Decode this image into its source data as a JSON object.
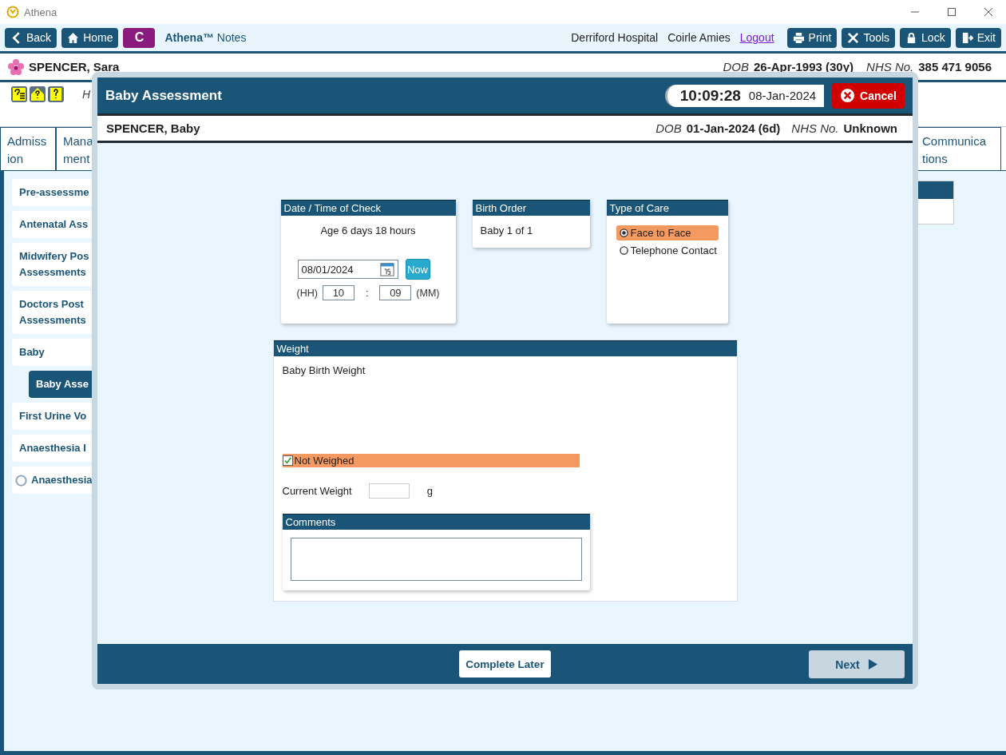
{
  "window": {
    "title": "Athena"
  },
  "toolbar": {
    "nav_buttons": [
      {
        "label": "Back"
      },
      {
        "label": "Home"
      }
    ],
    "c_button": "C",
    "app_name": "**Athena™** Notes",
    "hospital": "Derriford Hospital",
    "user": "Coirle Amies",
    "logout": "Logout",
    "actions": [
      {
        "label": "Print"
      },
      {
        "label": "Tools"
      },
      {
        "label": "Lock"
      },
      {
        "label": "Exit"
      }
    ]
  },
  "patient": {
    "name": "SPENCER, Sara",
    "dob_label": "DOB",
    "dob": "26-Apr-1993 (30y)",
    "nhs_label": "NHS No.",
    "nhs": "385 471 9056"
  },
  "alert_text": "H",
  "tabs": [
    {
      "lines": [
        "Admiss",
        "ion"
      ]
    },
    {
      "lines": [
        "Mana",
        "ment"
      ]
    },
    {
      "lines": [
        "Communica",
        "tions"
      ]
    }
  ],
  "sidebar": {
    "items": [
      {
        "lines": [
          "Pre-assessme"
        ],
        "kind": "plain",
        "selected": false
      },
      {
        "lines": [
          "Antenatal Ass"
        ],
        "kind": "plain",
        "selected": false
      },
      {
        "lines": [
          "Midwifery Pos",
          "Assessments"
        ],
        "kind": "plain",
        "selected": false
      },
      {
        "lines": [
          "Doctors Post",
          "Assessments"
        ],
        "kind": "plain",
        "selected": false
      },
      {
        "lines": [
          "Baby"
        ],
        "kind": "plain",
        "selected": false,
        "children": [
          {
            "lines": [
              "Baby Asse"
            ],
            "selected": true
          }
        ]
      },
      {
        "lines": [
          "First Urine Vo"
        ],
        "kind": "plain",
        "selected": false
      },
      {
        "lines": [
          "Anaesthesia I"
        ],
        "kind": "plain",
        "selected": false
      },
      {
        "lines": [
          "Anaesthesia"
        ],
        "kind": "radio",
        "selected": false
      }
    ]
  },
  "modal": {
    "title": "Baby Assessment",
    "time": "10:09:28",
    "date": "08-Jan-2024",
    "cancel": "Cancel",
    "baby": {
      "name": "SPENCER, Baby",
      "dob_label": "DOB",
      "dob": "01-Jan-2024 (6d)",
      "nhs_label": "NHS No.",
      "nhs": "Unknown"
    },
    "date_card": {
      "title": "Date / Time of Check",
      "age": "Age 6 days 18 hours",
      "date": "08/01/2024",
      "now": "Now",
      "hh_label": "(HH)",
      "hh": "10",
      "sep": ":",
      "mm": "09",
      "mm_label": "(MM)"
    },
    "birth_order": {
      "title": "Birth Order",
      "value": "Baby 1 of 1"
    },
    "type_of_care": {
      "title": "Type of Care",
      "options": [
        {
          "label": "Face to Face",
          "selected": true
        },
        {
          "label": "Telephone Contact",
          "selected": false
        }
      ]
    },
    "weight": {
      "title": "Weight",
      "birth_weight_label": "Baby Birth Weight",
      "not_weighed": {
        "label": "Not Weighed",
        "checked": true
      },
      "current_weight_label": "Current Weight",
      "unit": "g",
      "comments_title": "Comments"
    },
    "footer": {
      "complete_later": "Complete Later",
      "next": {
        "label": "Next",
        "disabled": true
      }
    }
  }
}
